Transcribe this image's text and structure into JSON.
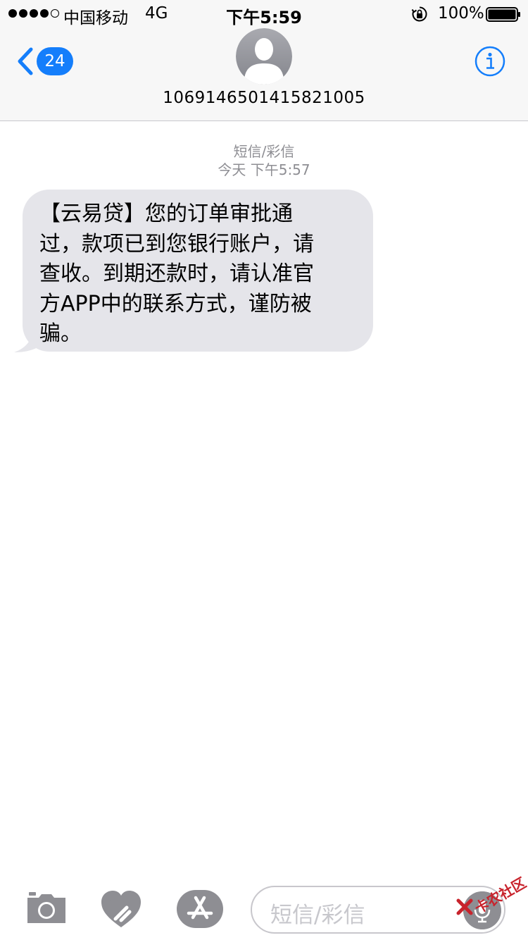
{
  "status_bar": {
    "carrier": "中国移动",
    "network": "4G",
    "time": "下午5:59",
    "battery": "100%",
    "signal_bars_filled": 4,
    "signal_bars_total": 5
  },
  "header": {
    "back_count": "24",
    "contact": "1069146501415821005"
  },
  "conversation": {
    "message_type": "短信/彩信",
    "timestamp": "今天 下午5:57",
    "messages": [
      {
        "direction": "incoming",
        "lines": [
          "【云易贷】您的订单审批通",
          "过，款项已到您银行账户，请",
          "查收。到期还款时，请认准官",
          "方APP中的联系方式，谨防被",
          "骗。"
        ]
      }
    ]
  },
  "input_bar": {
    "placeholder": "短信/彩信"
  },
  "watermark": {
    "text": "卡农社区"
  },
  "colors": {
    "accent": "#147efb",
    "bubble_incoming": "#e5e5ea",
    "meta_text": "#8e8e93",
    "bar_background": "#f7f7f7",
    "watermark": "#c8232c"
  },
  "icons": {
    "back": "chevron-left-icon",
    "info": "info-icon",
    "camera": "camera-icon",
    "digital_touch": "heart-icon",
    "app_store": "app-store-icon",
    "mic": "microphone-icon"
  }
}
